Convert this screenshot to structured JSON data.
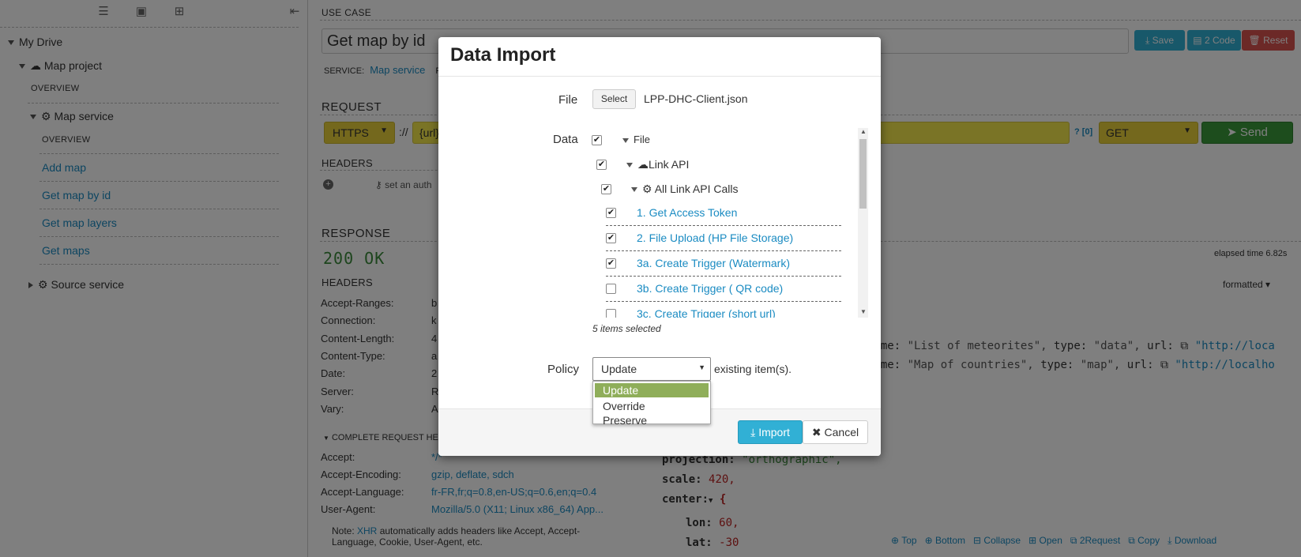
{
  "sidebar": {
    "toolbar_icons": [
      "list-icon",
      "archive-icon",
      "grid-icon",
      "collapse-icon"
    ],
    "root": "My Drive",
    "project": "Map project",
    "overview1": "OVERVIEW",
    "service": "Map service",
    "overview2": "OVERVIEW",
    "requests": [
      "Add map",
      "Get map by id",
      "Get map layers",
      "Get maps"
    ],
    "source_service": "Source service"
  },
  "main": {
    "use_case_label": "USE CASE",
    "use_case_title": "Get map by id",
    "save": "Save",
    "code": "2 Code",
    "reset": "Reset",
    "service_label": "SERVICE:",
    "service_name": "Map service",
    "service_extra": "P",
    "request_label": "REQUEST",
    "scheme": "HTTPS",
    "scheme_sep": "://",
    "url": "{url}",
    "param_count": "? [0]",
    "method": "GET",
    "send": "Send",
    "headers_label": "HEADERS",
    "set_auth": "set an auth",
    "response_label": "RESPONSE",
    "status": "200 OK",
    "elapsed": "elapsed time 6.82s",
    "resp_headers_label": "HEADERS",
    "formatted": "formatted",
    "resp_headers": [
      {
        "k": "Accept-Ranges:",
        "v": "b"
      },
      {
        "k": "Connection:",
        "v": "k"
      },
      {
        "k": "Content-Length:",
        "v": "4"
      },
      {
        "k": "Content-Type:",
        "v": "a"
      },
      {
        "k": "Date:",
        "v": "2"
      },
      {
        "k": "Server:",
        "v": "R"
      },
      {
        "k": "Vary:",
        "v": "A"
      }
    ],
    "complete_req_headers": "COMPLETE REQUEST HE",
    "req_headers": [
      {
        "k": "Accept:",
        "v": "*/*"
      },
      {
        "k": "Accept-Encoding:",
        "v": "gzip, deflate, sdch"
      },
      {
        "k": "Accept-Language:",
        "v": "fr-FR,fr;q=0.8,en-US;q=0.6,en;q=0.4"
      },
      {
        "k": "User-Agent:",
        "v": "Mozilla/5.0 (X11; Linux x86_64) App..."
      }
    ],
    "note_prefix": "Note: ",
    "note_link": "XHR",
    "note_line1": " automatically adds headers like Accept, Accept-",
    "note_line2": "Language, Cookie, User-Agent, etc.",
    "json_line1_a": "name:",
    "json_line1_b": "\"List of meteorites\",",
    "json_line1_c": "type:",
    "json_line1_d": "\"data\",",
    "json_line1_e": "url:",
    "json_line1_f": "\"http://loca",
    "json_line2_a": "name:",
    "json_line2_b": "\"Map of countries\",",
    "json_line2_c": "type:",
    "json_line2_d": "\"map\",",
    "json_line2_e": "url:",
    "json_line2_f": "\"http://localho",
    "json_projection_k": "projection:",
    "json_projection_v": "\"orthographic\",",
    "json_scale_k": "scale:",
    "json_scale_v": "420,",
    "json_center_k": "center:",
    "json_center_v": "{",
    "json_lon_k": "lon:",
    "json_lon_v": "60,",
    "json_lat_k": "lat:",
    "json_lat_v": "-30",
    "bottom_links": [
      "Top",
      "Bottom",
      "Collapse",
      "Open",
      "2Request",
      "Copy",
      "Download"
    ]
  },
  "modal": {
    "title": "Data Import",
    "file_label": "File",
    "select_btn": "Select",
    "file_name": "LPP-DHC-Client.json",
    "data_label": "Data",
    "tree": {
      "file": "File",
      "link_api": "Link API",
      "all_calls": "All Link API Calls",
      "items": [
        "1. Get Access Token",
        "2. File Upload (HP File Storage)",
        "3a. Create Trigger (Watermark)",
        "3b. Create Trigger ( QR code)",
        "3c. Create Trigger (short url)"
      ],
      "checked": [
        true,
        true,
        true,
        false,
        false
      ]
    },
    "selected_count": "5 items selected",
    "policy_label": "Policy",
    "policy_value": "Update",
    "policy_suffix": "existing item(s).",
    "policy_options": [
      "Update",
      "Override",
      "Preserve"
    ],
    "import_btn": "Import",
    "cancel_btn": "Cancel",
    "colors": {
      "primary": "#31b0d5",
      "success": "#4cae4c",
      "danger": "#d9534f",
      "highlight": "#8fae5a"
    }
  }
}
